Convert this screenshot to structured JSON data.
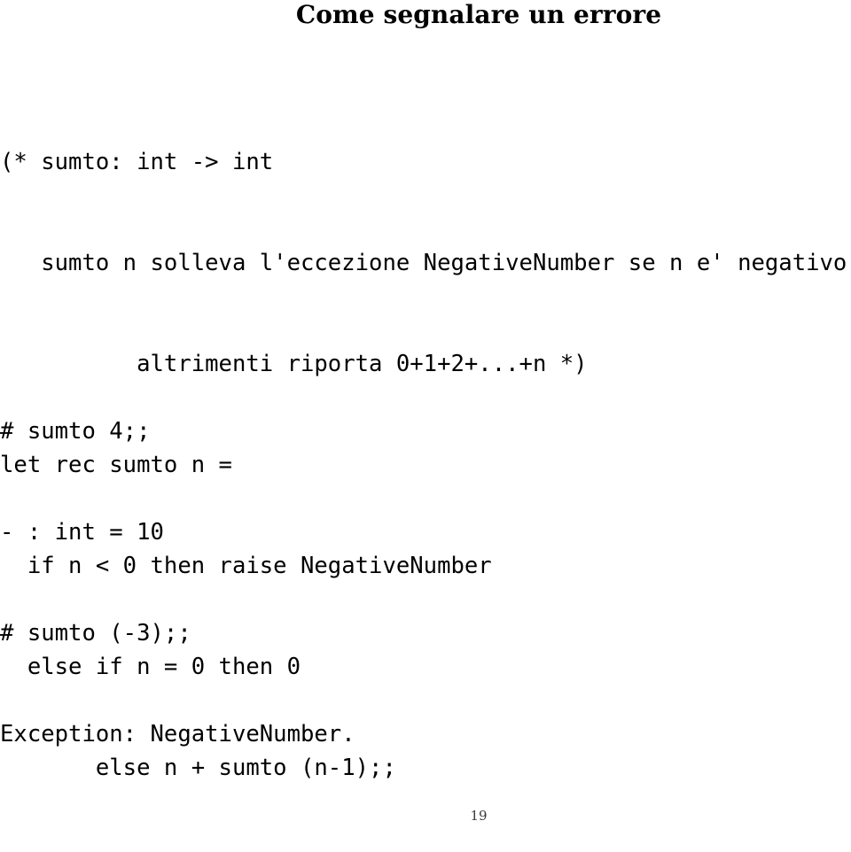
{
  "slide": {
    "title": "Come segnalare un errore",
    "page_number": "19",
    "code_block": {
      "name": "ocaml-source-code",
      "lines": [
        "(* sumto: int -> int",
        "   sumto n solleva l'eccezione NegativeNumber se n e' negativo,",
        "          altrimenti riporta 0+1+2+...+n *)",
        "let rec sumto n =",
        "  if n < 0 then raise NegativeNumber",
        "  else if n = 0 then 0",
        "       else n + sumto (n-1);;"
      ]
    },
    "session_block": {
      "name": "ocaml-toplevel-session",
      "lines": [
        "# sumto 4;;",
        "- : int = 10",
        "# sumto (-3);;",
        "Exception: NegativeNumber."
      ]
    }
  }
}
